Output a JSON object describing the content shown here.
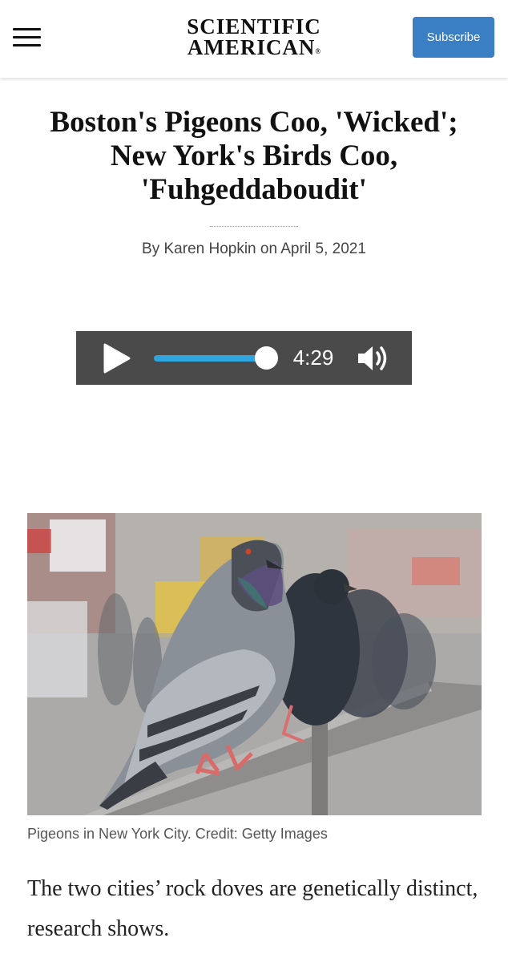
{
  "header": {
    "logo_line1": "SCIENTIFIC",
    "logo_line2": "AMERICAN",
    "logo_mark": "®",
    "subscribe_label": "Subscribe",
    "menu_icon": "hamburger-menu-icon"
  },
  "article": {
    "headline": "Boston's Pigeons Coo, 'Wicked'; New York's Birds Coo, 'Fuhgeddaboudit'",
    "byline": "By Karen Hopkin on April 5, 2021"
  },
  "audio_player": {
    "play_icon": "play-icon",
    "progress": 1.0,
    "duration": "4:29",
    "volume_icon": "volume-icon",
    "accent_color": "#2fa5dd"
  },
  "image": {
    "caption": "Pigeons in New York City. Credit: Getty Images"
  },
  "body": {
    "lead": "The two cities’ rock doves are genetically distinct, research shows."
  },
  "colors": {
    "subscribe_bg": "#3a7fc4",
    "player_bg": "#4a4a4a"
  }
}
